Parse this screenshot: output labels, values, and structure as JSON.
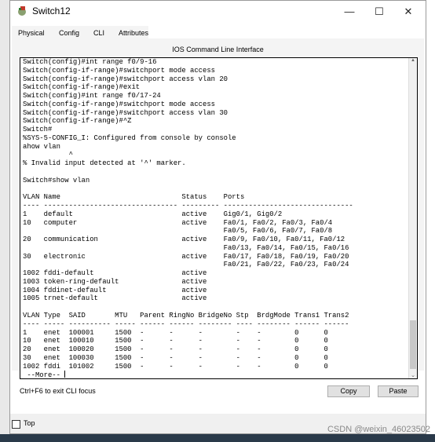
{
  "window": {
    "title": "Switch12",
    "minimize": "—",
    "maximize": "☐",
    "close": "✕"
  },
  "tabs": [
    {
      "label": "Physical",
      "active": false
    },
    {
      "label": "Config",
      "active": false
    },
    {
      "label": "CLI",
      "active": true
    },
    {
      "label": "Attributes",
      "active": false
    }
  ],
  "cli": {
    "title": "IOS Command Line Interface",
    "lines": [
      "Switch(config)#int range f0/9-16",
      "Switch(config-if-range)#switchport mode access",
      "Switch(config-if-range)#switchport access vlan 20",
      "Switch(config-if-range)#exit",
      "Switch(config)#int range f0/17-24",
      "Switch(config-if-range)#switchport mode access",
      "Switch(config-if-range)#switchport access vlan 30",
      "Switch(config-if-range)#^Z",
      "Switch#",
      "%SYS-5-CONFIG_I: Configured from console by console",
      "ahow vlan",
      "           ^",
      "% Invalid input detected at '^' marker.",
      "",
      "Switch#show vlan",
      "",
      "VLAN Name                             Status    Ports",
      "---- -------------------------------- --------- -------------------------------",
      "1    default                          active    Gig0/1, Gig0/2",
      "10   computer                         active    Fa0/1, Fa0/2, Fa0/3, Fa0/4",
      "                                                Fa0/5, Fa0/6, Fa0/7, Fa0/8",
      "20   communication                    active    Fa0/9, Fa0/10, Fa0/11, Fa0/12",
      "                                                Fa0/13, Fa0/14, Fa0/15, Fa0/16",
      "30   electronic                       active    Fa0/17, Fa0/18, Fa0/19, Fa0/20",
      "                                                Fa0/21, Fa0/22, Fa0/23, Fa0/24",
      "1002 fddi-default                     active    ",
      "1003 token-ring-default               active    ",
      "1004 fddinet-default                  active    ",
      "1005 trnet-default                    active    ",
      "",
      "VLAN Type  SAID       MTU   Parent RingNo BridgeNo Stp  BrdgMode Trans1 Trans2",
      "---- ----- ---------- ----- ------ ------ -------- ---- -------- ------ ------",
      "1    enet  100001     1500  -      -      -        -    -        0      0",
      "10   enet  100010     1500  -      -      -        -    -        0      0",
      "20   enet  100020     1500  -      -      -        -    -        0      0",
      "30   enet  100030     1500  -      -      -        -    -        0      0",
      "1002 fddi  101002     1500  -      -      -        -    -        0      0"
    ],
    "more_prompt": " --More-- "
  },
  "footer": {
    "hint": "Ctrl+F6 to exit CLI focus",
    "copy": "Copy",
    "paste": "Paste"
  },
  "bottom": {
    "top_label": "Top",
    "top_checked": false
  },
  "watermark": "CSDN @weixin_46023502"
}
